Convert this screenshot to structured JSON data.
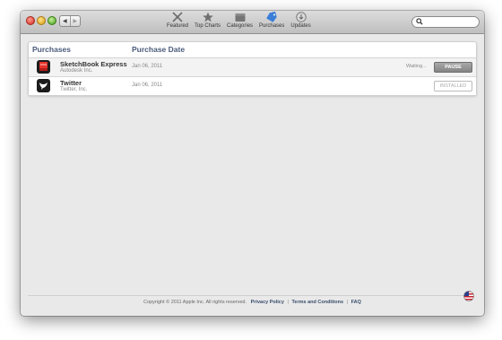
{
  "toolbar": {
    "back_glyph": "◀",
    "forward_glyph": "▶",
    "tabs": [
      {
        "label": "Featured",
        "icon": "featured-icon"
      },
      {
        "label": "Top Charts",
        "icon": "star-icon"
      },
      {
        "label": "Categories",
        "icon": "categories-icon"
      },
      {
        "label": "Purchases",
        "icon": "purchases-tag-icon",
        "active": true
      },
      {
        "label": "Updates",
        "icon": "updates-download-icon"
      }
    ],
    "search": {
      "value": "",
      "placeholder": ""
    }
  },
  "table": {
    "header_purchases": "Purchases",
    "header_date": "Purchase Date",
    "rows": [
      {
        "name": "SketchBook Express",
        "developer": "Autodesk Inc.",
        "date": "Jan 06, 2011",
        "status": "Waiting...",
        "button": "PAUSE",
        "icon": "sketchbook-app-icon"
      },
      {
        "name": "Twitter",
        "developer": "Twitter, Inc.",
        "date": "Jan 06, 2011",
        "status": "",
        "button": "INSTALLED",
        "icon": "twitter-app-icon"
      }
    ]
  },
  "footer": {
    "copyright": "Copyright © 2011 Apple Inc. All rights reserved.",
    "privacy": "Privacy Policy",
    "terms": "Terms and Conditions",
    "faq": "FAQ",
    "separator": "|",
    "flag_icon": "us-flag-icon"
  },
  "colors": {
    "link": "#3a4d6d",
    "header_text": "#4a5b7a",
    "active_tab": "#3b7ed8"
  }
}
